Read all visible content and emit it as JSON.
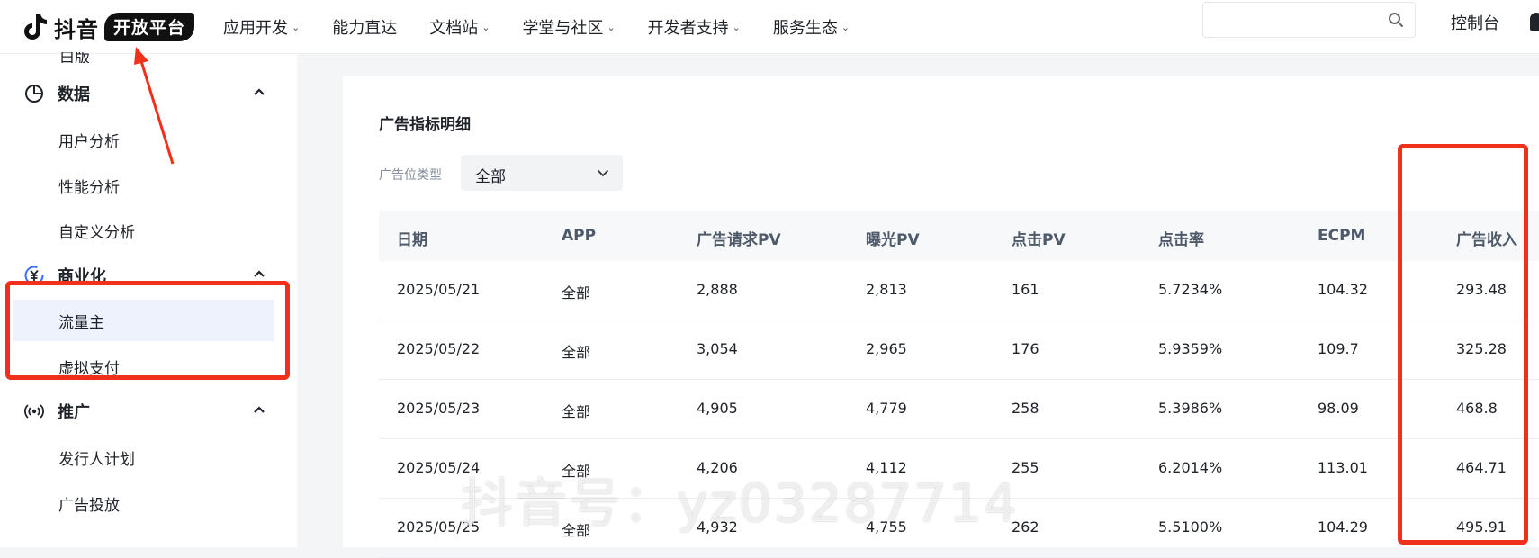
{
  "header": {
    "logo_text": "抖音",
    "logo_pill": "开放平台",
    "nav": [
      {
        "label": "应用开发",
        "has_dropdown": true
      },
      {
        "label": "能力直达",
        "has_dropdown": false
      },
      {
        "label": "文档站",
        "has_dropdown": true
      },
      {
        "label": "学堂与社区",
        "has_dropdown": true
      },
      {
        "label": "开发者支持",
        "has_dropdown": true
      },
      {
        "label": "服务生态",
        "has_dropdown": true
      }
    ],
    "search_placeholder": "",
    "console": "控制台"
  },
  "sidebar": {
    "cut_item": "白版",
    "groups": [
      {
        "label": "数据",
        "icon": "pie-chart-icon",
        "items": [
          "用户分析",
          "性能分析",
          "自定义分析"
        ]
      },
      {
        "label": "商业化",
        "icon": "yuan-coin-icon",
        "items": [
          "流量主",
          "虚拟支付"
        ],
        "active_item": "流量主"
      },
      {
        "label": "推广",
        "icon": "broadcast-icon",
        "items": [
          "发行人计划",
          "广告投放"
        ]
      }
    ]
  },
  "main": {
    "title": "广告指标明细",
    "filter_label": "广告位类型",
    "filter_value": "全部",
    "columns": [
      "日期",
      "APP",
      "广告请求PV",
      "曝光PV",
      "点击PV",
      "点击率",
      "ECPM",
      "广告收入"
    ],
    "rows": [
      [
        "2025/05/21",
        "全部",
        "2,888",
        "2,813",
        "161",
        "5.7234%",
        "104.32",
        "293.48"
      ],
      [
        "2025/05/22",
        "全部",
        "3,054",
        "2,965",
        "176",
        "5.9359%",
        "109.7",
        "325.28"
      ],
      [
        "2025/05/23",
        "全部",
        "4,905",
        "4,779",
        "258",
        "5.3986%",
        "98.09",
        "468.8"
      ],
      [
        "2025/05/24",
        "全部",
        "4,206",
        "4,112",
        "255",
        "6.2014%",
        "113.01",
        "464.71"
      ],
      [
        "2025/05/25",
        "全部",
        "4,932",
        "4,755",
        "262",
        "5.5100%",
        "104.29",
        "495.91"
      ]
    ]
  },
  "watermark": "抖音号：yz03287714",
  "colors": {
    "annotation": "#f1301c",
    "active_bg": "#eef2fd",
    "accent": "#3a6ff7"
  }
}
